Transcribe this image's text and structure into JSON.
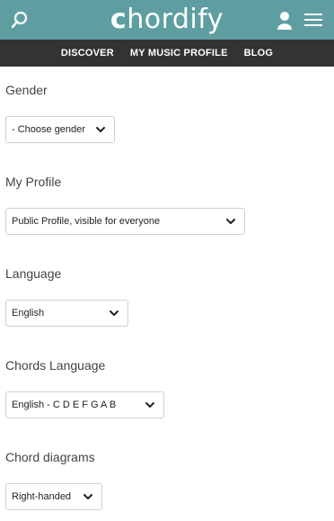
{
  "header": {
    "logo_prefix": "c",
    "logo_rest": "hordify",
    "logo_text": "chordify"
  },
  "nav": {
    "items": [
      "DISCOVER",
      "MY MUSIC PROFILE",
      "BLOG"
    ]
  },
  "form": {
    "gender": {
      "label": "Gender",
      "value": "- Choose gender"
    },
    "profile": {
      "label": "My Profile",
      "value": "Public Profile, visible for everyone"
    },
    "language": {
      "label": "Language",
      "value": "English"
    },
    "chords_language": {
      "label": "Chords Language",
      "value": "English - C D E F G A B"
    },
    "chord_diagrams": {
      "label": "Chord diagrams",
      "value": "Right-handed"
    }
  },
  "icons": {
    "search": "search-icon",
    "user": "user-icon",
    "menu": "hamburger-menu-icon",
    "chevron": "chevron-down-icon"
  },
  "colors": {
    "header_bg": "#5f9ea0",
    "nav_bg": "#333333"
  }
}
